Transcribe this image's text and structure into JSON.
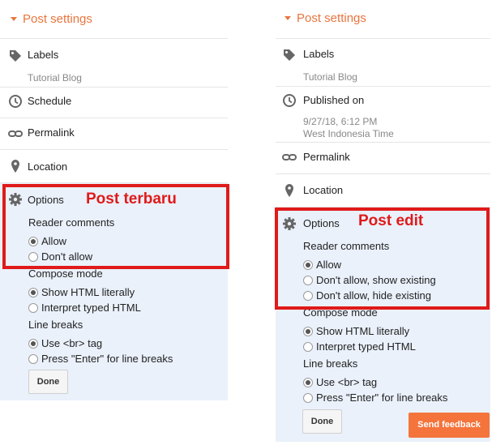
{
  "left": {
    "header": "Post settings",
    "labels": {
      "title": "Labels",
      "value": "Tutorial Blog"
    },
    "schedule": {
      "title": "Schedule"
    },
    "permalink": "Permalink",
    "location": "Location",
    "options": {
      "title": "Options",
      "reader_comments": "Reader comments",
      "comment_choices": [
        "Allow",
        "Don't allow"
      ],
      "compose_mode": "Compose mode",
      "compose_choices": [
        "Show HTML literally",
        "Interpret typed HTML"
      ],
      "line_breaks": "Line breaks",
      "line_break_choices": [
        "Use <br> tag",
        "Press \"Enter\" for line breaks"
      ],
      "done": "Done"
    },
    "annotation": "Post terbaru"
  },
  "right": {
    "header": "Post settings",
    "labels": {
      "title": "Labels",
      "value": "Tutorial Blog"
    },
    "published": {
      "title": "Published on",
      "date": "9/27/18, 6:12 PM",
      "timezone": "West Indonesia Time"
    },
    "permalink": "Permalink",
    "location": "Location",
    "options": {
      "title": "Options",
      "reader_comments": "Reader comments",
      "comment_choices": [
        "Allow",
        "Don't allow, show existing",
        "Don't allow, hide existing"
      ],
      "compose_mode": "Compose mode",
      "compose_choices": [
        "Show HTML literally",
        "Interpret typed HTML"
      ],
      "line_breaks": "Line breaks",
      "line_break_choices": [
        "Use <br> tag",
        "Press \"Enter\" for line breaks"
      ],
      "done": "Done"
    },
    "annotation": "Post edit"
  },
  "feedback_button": "Send feedback",
  "colors": {
    "accent": "#e8753d",
    "annotation": "#e01a1a",
    "options_bg": "#eaf1fb",
    "feedback_bg": "#f4743c"
  }
}
